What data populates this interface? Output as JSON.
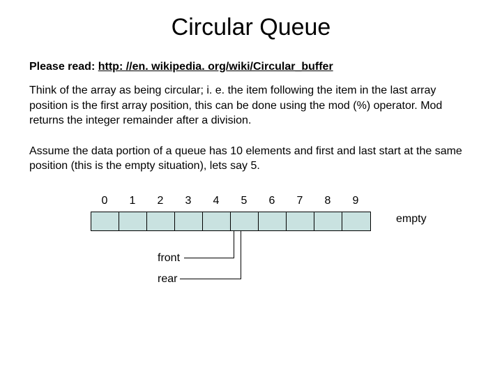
{
  "title": "Circular Queue",
  "read_prefix": "Please read:  ",
  "read_link_text": "http: //en. wikipedia. org/wiki/Circular_buffer",
  "paragraph1": "Think of the array as being circular; i. e. the item following the item in the last array position is the first array position, this can be done using the mod (%) operator. Mod returns the integer remainder after a division.",
  "paragraph2": "Assume the data portion of a queue has 10 elements and first and last start at the same position (this is the empty situation), lets say 5.",
  "indices": [
    "0",
    "1",
    "2",
    "3",
    "4",
    "5",
    "6",
    "7",
    "8",
    "9"
  ],
  "cell_count": 10,
  "empty_label": "empty",
  "front_label": "front",
  "rear_label": "rear",
  "front_points_to_index": 5,
  "rear_points_to_index": 5,
  "cell_fill_color": "#c9e2e0"
}
